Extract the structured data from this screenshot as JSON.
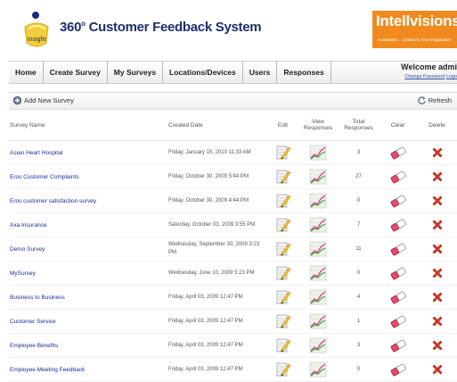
{
  "header": {
    "app_title": "360",
    "app_title_sup": "o",
    "app_title_rest": " Customer Feedback System",
    "brand_name": "Intellvisions",
    "brand_tagline": "Automation... Limited to Your Imagination"
  },
  "nav": {
    "items": [
      "Home",
      "Create Survey",
      "My Surveys",
      "Locations/Devices",
      "Users",
      "Responses"
    ],
    "welcome": "Welcome admi",
    "change_password": "Change Password",
    "logout": "Logo"
  },
  "toolbar": {
    "add_label": "Add New Survey",
    "refresh_label": "Refresh"
  },
  "table": {
    "columns": {
      "name": "Survey Name",
      "created": "Created Date",
      "edit": "Edit",
      "view": "View Responses",
      "total": "Total Responses",
      "clear": "Clear",
      "delete": "Delete"
    },
    "rows": [
      {
        "name": "Asian Heart Hospital",
        "date": "Friday, January 15, 2010 11:33 AM",
        "total": "3"
      },
      {
        "name": "Eros Customer Complaints",
        "date": "Friday, October 30, 2009 5:44 PM",
        "total": "27"
      },
      {
        "name": "Eros customer satisfaction survey",
        "date": "Friday, October 30, 2009 4:44 PM",
        "total": "0"
      },
      {
        "name": "Axa Insurance",
        "date": "Saturday, October 03, 2009 3:55 PM",
        "total": "7"
      },
      {
        "name": "Demo Survey",
        "date": "Wednesday, September 30, 2009 3:23 PM",
        "total": "11"
      },
      {
        "name": "MySurvey",
        "date": "Wednesday, June 10, 2009 5:23 PM",
        "total": "0"
      },
      {
        "name": "Business to Business",
        "date": "Friday, April 03, 2009 12:47 PM",
        "total": "4"
      },
      {
        "name": "Customer Service",
        "date": "Friday, April 03, 2009 12:47 PM",
        "total": "1"
      },
      {
        "name": "Employee Benefits",
        "date": "Friday, April 03, 2009 12:47 PM",
        "total": "3"
      },
      {
        "name": "Employee Meeting Feedback",
        "date": "Friday, April 03, 2009 12:47 PM",
        "total": "0"
      }
    ]
  },
  "colors": {
    "title": "#1f2f6b",
    "brand": "#f08a1e",
    "link": "#1a2c9a",
    "delete": "#d93a2b"
  },
  "icons": {
    "edit": "pencil-notepad-icon",
    "view": "chart-icon",
    "clear": "eraser-icon",
    "delete": "red-x-icon",
    "add": "plus-circle-icon",
    "refresh": "refresh-icon"
  }
}
